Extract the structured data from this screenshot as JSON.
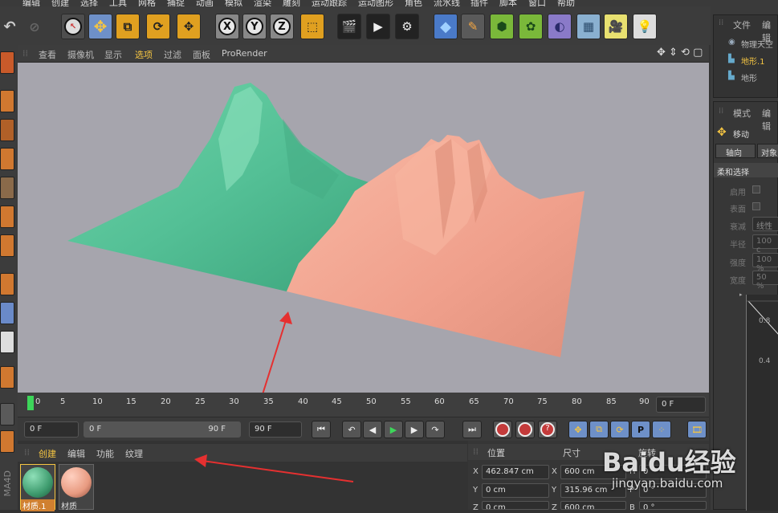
{
  "menu": [
    "编辑",
    "创建",
    "选择",
    "工具",
    "网格",
    "捕捉",
    "动画",
    "模拟",
    "渲染",
    "雕刻",
    "运动跟踪",
    "运动图形",
    "角色",
    "流水线",
    "插件",
    "脚本",
    "窗口",
    "帮助"
  ],
  "toolbar": {
    "axis_labels": [
      "X",
      "Y",
      "Z"
    ]
  },
  "viewport_menu": [
    "查看",
    "摄像机",
    "显示",
    "选项",
    "过滤",
    "面板",
    "ProRender"
  ],
  "viewport_menu_active": "选项",
  "timeline": {
    "ticks": [
      "0",
      "5",
      "10",
      "15",
      "20",
      "25",
      "30",
      "35",
      "40",
      "45",
      "50",
      "55",
      "60",
      "65",
      "70",
      "75",
      "80",
      "85",
      "90"
    ],
    "current_frame_field": "0 F"
  },
  "playbar": {
    "start_field": "0 F",
    "range_start": "0 F",
    "range_end": "90 F",
    "end_field": "90 F"
  },
  "material_panel": {
    "tabs": [
      "创建",
      "编辑",
      "功能",
      "纹理"
    ],
    "materials": [
      {
        "name": "材质.1",
        "color": "#3e9b6e"
      },
      {
        "name": "材质",
        "color": "#e89a80"
      }
    ]
  },
  "coordinates": {
    "headers": {
      "position": "位置",
      "size": "尺寸",
      "rotation": "旋转"
    },
    "rows": [
      {
        "axis": "X",
        "pos": "462.847 cm",
        "size_axis": "X",
        "size": "600 cm",
        "rot_axis": "H",
        "rot": "0 °"
      },
      {
        "axis": "Y",
        "pos": "0 cm",
        "size_axis": "Y",
        "size": "315.96 cm",
        "rot_axis": "P",
        "rot": "0 °"
      },
      {
        "axis": "Z",
        "pos": "0 cm",
        "size_axis": "Z",
        "size": "600 cm",
        "rot_axis": "B",
        "rot": "0 °"
      }
    ]
  },
  "object_manager": {
    "menu": [
      "文件",
      "编辑"
    ],
    "objects": [
      {
        "name": "物理天空",
        "selected": false
      },
      {
        "name": "地形.1",
        "selected": true
      },
      {
        "name": "地形",
        "selected": false
      }
    ]
  },
  "attributes": {
    "menu": [
      "模式",
      "编辑"
    ],
    "tool_name": "移动",
    "tabs": [
      "轴向",
      "对象"
    ],
    "section": "柔和选择",
    "fields": [
      {
        "label": "启用",
        "value": ""
      },
      {
        "label": "表面",
        "value": ""
      },
      {
        "label": "衰减",
        "value": "线性"
      },
      {
        "label": "半径",
        "value": "100 c"
      },
      {
        "label": "强度",
        "value": "100 %"
      },
      {
        "label": "宽度",
        "value": "50 %"
      }
    ],
    "graph_ticks": [
      "0.8",
      "0.4"
    ]
  },
  "side_label": "MA4D",
  "watermark": {
    "brand": "Baidu经验",
    "url": "jingyan.baidu.com"
  },
  "colors": {
    "accent_blue": "#6e90c8",
    "terrain_green": "#5cc49a",
    "terrain_salmon": "#f0a08c",
    "annotation_red": "#e53030",
    "active_yellow": "#f5c542"
  }
}
